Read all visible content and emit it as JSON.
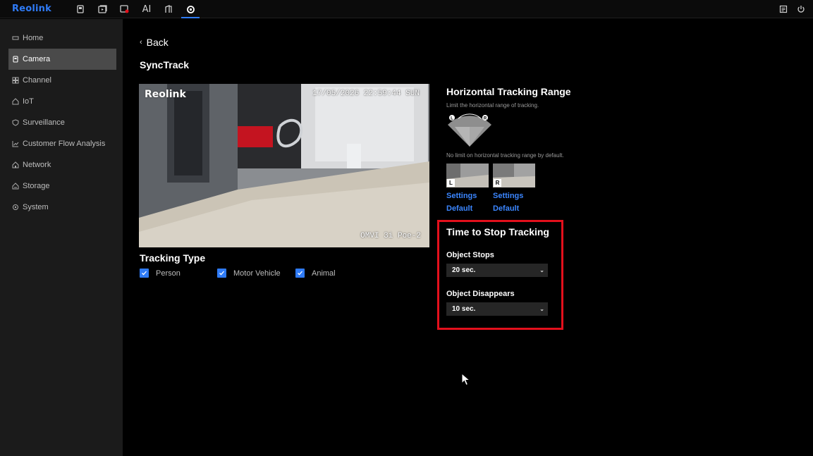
{
  "app": {
    "logo": "Reolink"
  },
  "topnav": [
    {
      "name": "device-icon",
      "label": ""
    },
    {
      "name": "playback-icon",
      "label": ""
    },
    {
      "name": "alarm-video-icon",
      "label": ""
    },
    {
      "name": "ai-icon",
      "label": "AI"
    },
    {
      "name": "door-icon",
      "label": ""
    },
    {
      "name": "settings-gear-icon",
      "label": "",
      "active": true
    }
  ],
  "sidebar": {
    "items": [
      {
        "label": "Home",
        "icon": "home-icon"
      },
      {
        "label": "Camera",
        "icon": "camera-icon",
        "active": true
      },
      {
        "label": "Channel",
        "icon": "channel-icon"
      },
      {
        "label": "IoT",
        "icon": "iot-icon"
      },
      {
        "label": "Surveillance",
        "icon": "shield-icon"
      },
      {
        "label": "Customer Flow Analysis",
        "icon": "chart-icon"
      },
      {
        "label": "Network",
        "icon": "network-icon"
      },
      {
        "label": "Storage",
        "icon": "storage-icon"
      },
      {
        "label": "System",
        "icon": "system-icon"
      }
    ]
  },
  "main": {
    "back_label": "Back",
    "title": "SyncTrack",
    "preview": {
      "osd_logo": "Reolink",
      "osd_time": "17/05/2026 22:59:44 SUN",
      "osd_name": "OMVI 3i Poe-2"
    },
    "tracking_type": {
      "title": "Tracking Type",
      "options": [
        {
          "label": "Person",
          "checked": true
        },
        {
          "label": "Motor Vehicle",
          "checked": true
        },
        {
          "label": "Animal",
          "checked": true
        }
      ]
    },
    "horizontal_range": {
      "title": "Horizontal Tracking Range",
      "subtitle": "Limit the horizontal range of tracking.",
      "note": "No limit on horizontal tracking range by default.",
      "left_tag": "L",
      "right_tag": "R",
      "left": {
        "settings": "Settings",
        "default": "Default"
      },
      "right": {
        "settings": "Settings",
        "default": "Default"
      }
    },
    "stop_tracking": {
      "title": "Time to Stop Tracking",
      "object_stops_label": "Object Stops",
      "object_stops_value": "20 sec.",
      "object_disappears_label": "Object Disappears",
      "object_disappears_value": "10 sec."
    }
  },
  "colors": {
    "accent": "#2f7bf6",
    "highlight": "#e3101c",
    "sidebar_bg": "#1b1b1b"
  }
}
